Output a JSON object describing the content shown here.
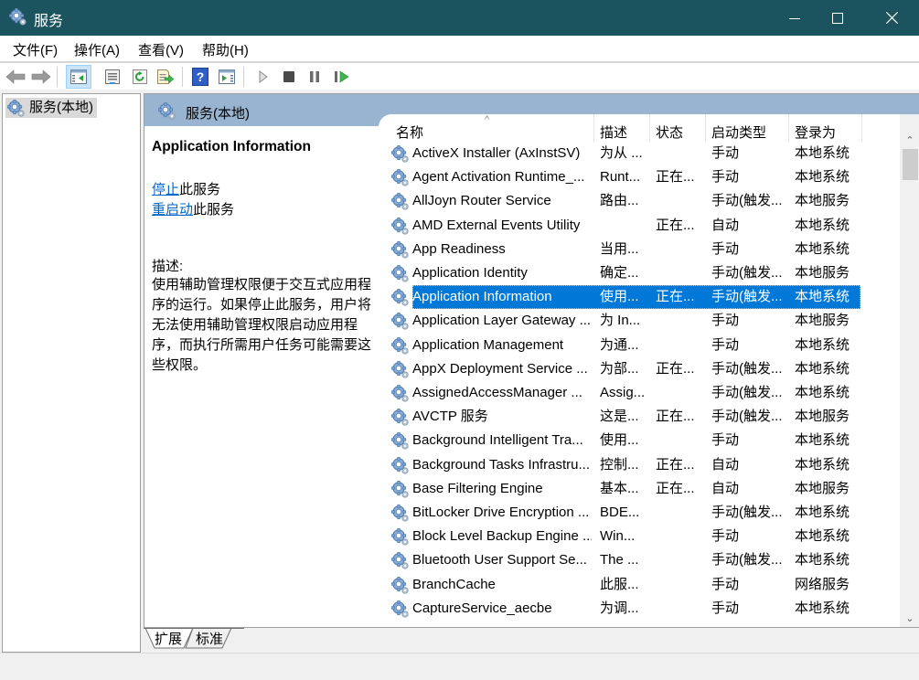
{
  "window": {
    "title": "服务",
    "icon": "gear-icon",
    "controls": {
      "minimize": "minimize-icon",
      "maximize": "maximize-icon",
      "close": "close-icon"
    }
  },
  "menubar": {
    "items": [
      {
        "label": "文件(F)"
      },
      {
        "label": "操作(A)"
      },
      {
        "label": "查看(V)"
      },
      {
        "label": "帮助(H)"
      }
    ]
  },
  "toolbar": {
    "buttons": [
      {
        "name": "back",
        "icon": "back-arrow-icon"
      },
      {
        "name": "forward",
        "icon": "forward-arrow-icon"
      },
      {
        "name": "show-hide-console-tree",
        "icon": "console-tree-icon",
        "active": true
      },
      {
        "name": "properties",
        "icon": "properties-icon"
      },
      {
        "name": "refresh",
        "icon": "refresh-icon"
      },
      {
        "name": "export-list",
        "icon": "export-list-icon"
      },
      {
        "name": "help",
        "icon": "help-icon"
      },
      {
        "name": "show-action-pane",
        "icon": "action-pane-icon"
      },
      {
        "name": "start-service",
        "icon": "play-icon"
      },
      {
        "name": "stop-service",
        "icon": "stop-icon"
      },
      {
        "name": "pause-service",
        "icon": "pause-icon"
      },
      {
        "name": "restart-service",
        "icon": "restart-icon"
      }
    ]
  },
  "tree": {
    "items": [
      {
        "label": "服务(本地)",
        "icon": "gear-icon",
        "selected": true
      }
    ]
  },
  "pane": {
    "header_title": "服务(本地)",
    "detail": {
      "service_name": "Application Information",
      "actions": [
        {
          "link": "停止",
          "suffix": "此服务"
        },
        {
          "link": "重启动",
          "suffix": "此服务"
        }
      ],
      "description_label": "描述:",
      "description_text": "使用辅助管理权限便于交互式应用程序的运行。如果停止此服务，用户将无法使用辅助管理权限启动应用程序，而执行所需用户任务可能需要这些权限。"
    },
    "columns": [
      {
        "label": "名称",
        "sorted": "ascending"
      },
      {
        "label": "描述"
      },
      {
        "label": "状态"
      },
      {
        "label": "启动类型"
      },
      {
        "label": "登录为"
      }
    ],
    "rows": [
      {
        "name": "ActiveX Installer (AxInstSV)",
        "desc": "为从 ...",
        "status": "",
        "startup": "手动",
        "logon": "本地系统"
      },
      {
        "name": "Agent Activation Runtime_...",
        "desc": "Runt...",
        "status": "正在...",
        "startup": "手动",
        "logon": "本地系统"
      },
      {
        "name": "AllJoyn Router Service",
        "desc": "路由...",
        "status": "",
        "startup": "手动(触发...",
        "logon": "本地服务"
      },
      {
        "name": "AMD External Events Utility",
        "desc": "",
        "status": "正在...",
        "startup": "自动",
        "logon": "本地系统"
      },
      {
        "name": "App Readiness",
        "desc": "当用...",
        "status": "",
        "startup": "手动",
        "logon": "本地系统"
      },
      {
        "name": "Application Identity",
        "desc": "确定...",
        "status": "",
        "startup": "手动(触发...",
        "logon": "本地服务"
      },
      {
        "name": "Application Information",
        "desc": "使用...",
        "status": "正在...",
        "startup": "手动(触发...",
        "logon": "本地系统",
        "selected": true
      },
      {
        "name": "Application Layer Gateway ...",
        "desc": "为 In...",
        "status": "",
        "startup": "手动",
        "logon": "本地服务"
      },
      {
        "name": "Application Management",
        "desc": "为通...",
        "status": "",
        "startup": "手动",
        "logon": "本地系统"
      },
      {
        "name": "AppX Deployment Service ...",
        "desc": "为部...",
        "status": "正在...",
        "startup": "手动(触发...",
        "logon": "本地系统"
      },
      {
        "name": "AssignedAccessManager ...",
        "desc": "Assig...",
        "status": "",
        "startup": "手动(触发...",
        "logon": "本地系统"
      },
      {
        "name": "AVCTP 服务",
        "desc": "这是...",
        "status": "正在...",
        "startup": "手动(触发...",
        "logon": "本地服务"
      },
      {
        "name": "Background Intelligent Tra...",
        "desc": "使用...",
        "status": "",
        "startup": "手动",
        "logon": "本地系统"
      },
      {
        "name": "Background Tasks Infrastru...",
        "desc": "控制...",
        "status": "正在...",
        "startup": "自动",
        "logon": "本地系统"
      },
      {
        "name": "Base Filtering Engine",
        "desc": "基本...",
        "status": "正在...",
        "startup": "自动",
        "logon": "本地服务"
      },
      {
        "name": "BitLocker Drive Encryption ...",
        "desc": "BDE...",
        "status": "",
        "startup": "手动(触发...",
        "logon": "本地系统"
      },
      {
        "name": "Block Level Backup Engine ...",
        "desc": "Win...",
        "status": "",
        "startup": "手动",
        "logon": "本地系统"
      },
      {
        "name": "Bluetooth User Support Se...",
        "desc": "The ...",
        "status": "",
        "startup": "手动(触发...",
        "logon": "本地系统"
      },
      {
        "name": "BranchCache",
        "desc": "此服...",
        "status": "",
        "startup": "手动",
        "logon": "网络服务"
      },
      {
        "name": "CaptureService_aecbe",
        "desc": "为调...",
        "status": "",
        "startup": "手动",
        "logon": "本地系统"
      }
    ]
  },
  "tabs": [
    {
      "label": "扩展",
      "active": true
    },
    {
      "label": "标准",
      "active": false
    }
  ],
  "colors": {
    "titlebar": "#1b535e",
    "pane_header": "#99b4d1",
    "selection": "#0078d7",
    "link": "#0066cc"
  }
}
